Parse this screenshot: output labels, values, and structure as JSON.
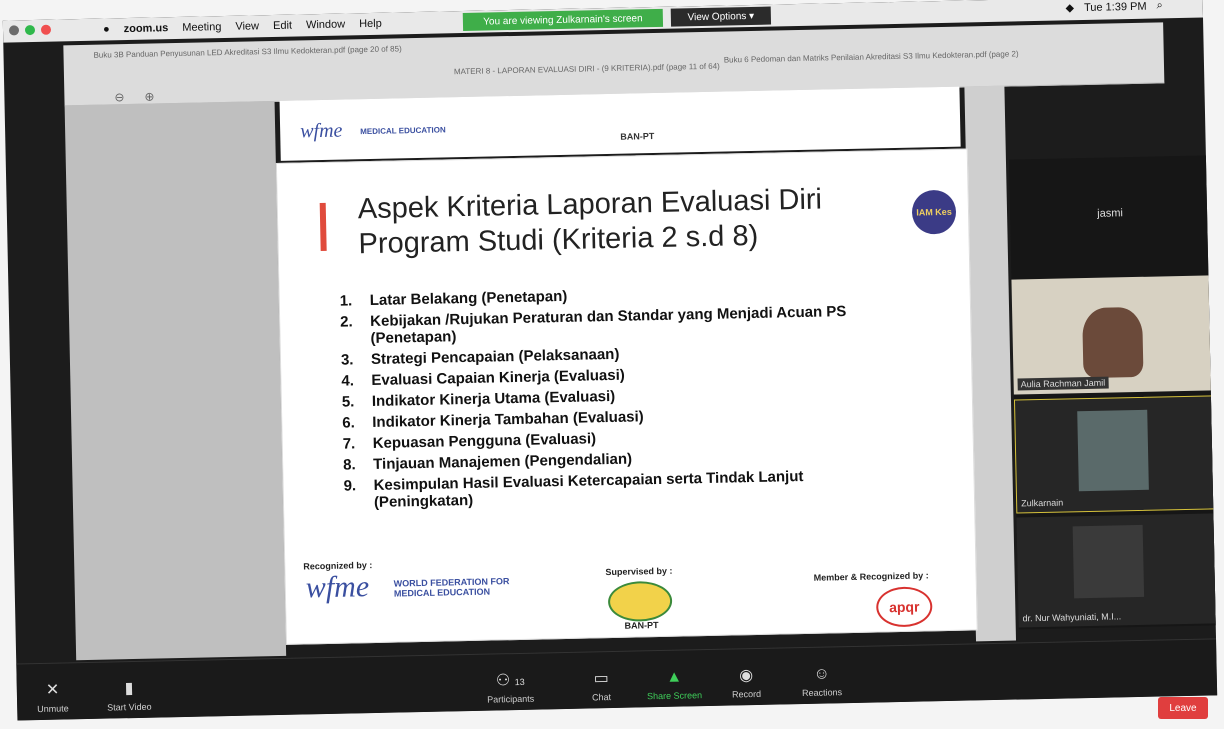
{
  "menubar": {
    "app": "zoom.us",
    "items": [
      "Meeting",
      "View",
      "Edit",
      "Window",
      "Help"
    ],
    "banner": "You are viewing Zulkarnain's screen",
    "view_options": "View Options ▾",
    "clock": "Tue 1:39 PM"
  },
  "browser": {
    "tab1": "Buku 3B Panduan Penyusunan LED Akreditasi S3 Ilmu Kedokteran.pdf (page 20 of 85)",
    "tab2": "MATERI 8 - LAPORAN EVALUASI DIRI - (9 KRITERIA).pdf (page 11 of 64)",
    "tab3": "Buku 6 Pedoman dan Matriks Penilaian Akreditasi S3 Ilmu Kedokteran.pdf (page 2)"
  },
  "slide_top": {
    "logo_text": "wfme",
    "logo_sub": "MEDICAL EDUCATION",
    "mark": "BAN-PT"
  },
  "slide": {
    "title": "Aspek Kriteria Laporan Evaluasi Diri Program Studi (Kriteria 2 s.d 8)",
    "items": [
      {
        "num": "1.",
        "text": "Latar Belakang (Penetapan)"
      },
      {
        "num": "2.",
        "text": "Kebijakan /Rujukan Peraturan dan Standar yang Menjadi Acuan PS (Penetapan)"
      },
      {
        "num": "3.",
        "text": "Strategi Pencapaian (Pelaksanaan)"
      },
      {
        "num": "4.",
        "text": "Evaluasi Capaian Kinerja (Evaluasi)"
      },
      {
        "num": "5.",
        "text": "Indikator Kinerja Utama (Evaluasi)"
      },
      {
        "num": "6.",
        "text": "Indikator Kinerja Tambahan (Evaluasi)"
      },
      {
        "num": "7.",
        "text": "Kepuasan Pengguna (Evaluasi)"
      },
      {
        "num": "8.",
        "text": "Tinjauan Manajemen (Pengendalian)"
      },
      {
        "num": "9.",
        "text": "Kesimpulan Hasil Evaluasi Ketercapaian serta Tindak Lanjut (Peningkatan)"
      }
    ],
    "recognized_by": "Recognized by :",
    "wfme": "wfme",
    "wfme_sub1": "WORLD FEDERATION FOR",
    "wfme_sub2": "MEDICAL EDUCATION",
    "supervised_by": "Supervised by :",
    "banpt": "BAN-PT",
    "member": "Member & Recognized by :",
    "apqr": "apqr",
    "iam_logo": "IAM Kes"
  },
  "participants": {
    "top_name": "jasmi",
    "p1": "Aulia Rachman Jamil",
    "p2": "Zulkarnain",
    "p3": "dr. Nur Wahyuniati, M.I..."
  },
  "toolbar": {
    "unmute": "Unmute",
    "start_video": "Start Video",
    "participants": "Participants",
    "participants_count": "13",
    "chat": "Chat",
    "share": "Share Screen",
    "record": "Record",
    "reactions": "Reactions",
    "leave": "Leave"
  }
}
